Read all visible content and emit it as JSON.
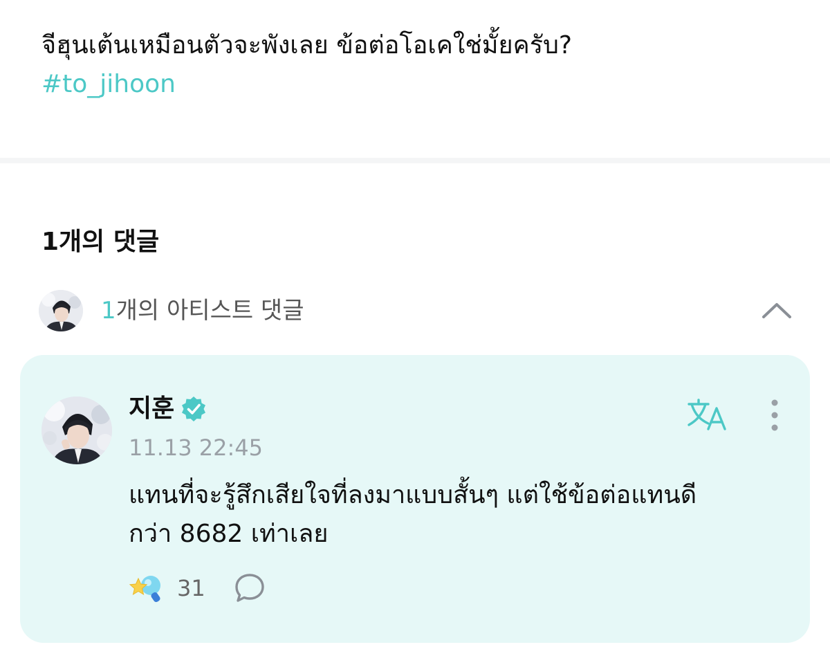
{
  "post": {
    "text": "จีฮุนเต้นเหมือนตัวจะพังเลย ข้อต่อโอเคใช่มั้ยครับ?",
    "hashtag": "#to_jihoon"
  },
  "comments": {
    "title": "1개의 댓글",
    "artist_section": {
      "count": "1",
      "label_rest": "개의 아티스트 댓글",
      "avatar_icon": "artist-avatar",
      "chevron_icon": "chevron-up-icon"
    },
    "artist_comment": {
      "author": "지훈",
      "verified_icon": "verified-badge-icon",
      "timestamp": "11.13 22:45",
      "body_line1": "แทนที่จะรู้สึกเสียใจที่ลงมาแบบสั้นๆ แต่ใช้ข้อต่อแทนดี",
      "body_line2": "กว่า 8682 เท่าเลย",
      "like_count": "31",
      "translate_icon": "translate-icon",
      "more_icon": "more-vertical-icon",
      "like_icon": "star-lightstick-icon",
      "reply_icon": "speech-bubble-icon"
    }
  },
  "colors": {
    "accent": "#4cc8c6",
    "card_background": "#e6f8f7",
    "muted_text": "#9aa0a6"
  }
}
